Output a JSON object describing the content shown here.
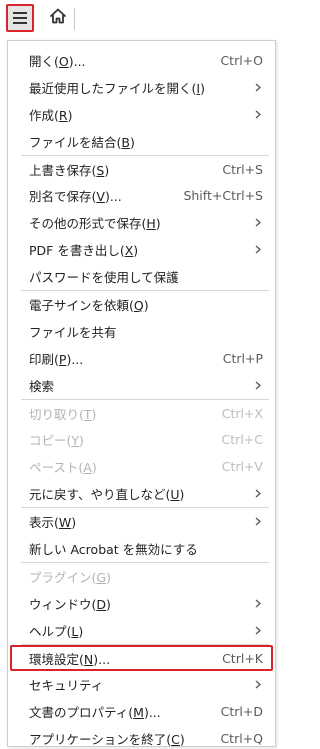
{
  "toolbar": {
    "menu_icon": "hamburger-menu-icon",
    "home_icon": "home-icon"
  },
  "menu": {
    "items": [
      {
        "label": "開く(",
        "mnemonic": "O",
        "suffix": ")...",
        "shortcut": "Ctrl+O",
        "submenu": false,
        "disabled": false
      },
      {
        "label": "最近使用したファイルを開く(",
        "mnemonic": "I",
        "suffix": ")",
        "shortcut": "",
        "submenu": true,
        "disabled": false
      },
      {
        "label": "作成(",
        "mnemonic": "R",
        "suffix": ")",
        "shortcut": "",
        "submenu": true,
        "disabled": false
      },
      {
        "label": "ファイルを結合(",
        "mnemonic": "B",
        "suffix": ")",
        "shortcut": "",
        "submenu": false,
        "disabled": false
      },
      {
        "label": "上書き保存(",
        "mnemonic": "S",
        "suffix": ")",
        "shortcut": "Ctrl+S",
        "submenu": false,
        "disabled": false
      },
      {
        "label": "別名で保存(",
        "mnemonic": "V",
        "suffix": ")...",
        "shortcut": "Shift+Ctrl+S",
        "submenu": false,
        "disabled": false
      },
      {
        "label": "その他の形式で保存(",
        "mnemonic": "H",
        "suffix": ")",
        "shortcut": "",
        "submenu": true,
        "disabled": false
      },
      {
        "label": "PDF を書き出し(",
        "mnemonic": "X",
        "suffix": ")",
        "shortcut": "",
        "submenu": true,
        "disabled": false
      },
      {
        "label": "パスワードを使用して保護",
        "mnemonic": "",
        "suffix": "",
        "shortcut": "",
        "submenu": false,
        "disabled": false
      },
      {
        "label": "電子サインを依頼(",
        "mnemonic": "Q",
        "suffix": ")",
        "shortcut": "",
        "submenu": false,
        "disabled": false
      },
      {
        "label": "ファイルを共有",
        "mnemonic": "",
        "suffix": "",
        "shortcut": "",
        "submenu": false,
        "disabled": false
      },
      {
        "label": "印刷(",
        "mnemonic": "P",
        "suffix": ")...",
        "shortcut": "Ctrl+P",
        "submenu": false,
        "disabled": false
      },
      {
        "label": "検索",
        "mnemonic": "",
        "suffix": "",
        "shortcut": "",
        "submenu": true,
        "disabled": false
      },
      {
        "label": "切り取り(",
        "mnemonic": "T",
        "suffix": ")",
        "shortcut": "Ctrl+X",
        "submenu": false,
        "disabled": true
      },
      {
        "label": "コピー(",
        "mnemonic": "Y",
        "suffix": ")",
        "shortcut": "Ctrl+C",
        "submenu": false,
        "disabled": true
      },
      {
        "label": "ペースト(",
        "mnemonic": "A",
        "suffix": ")",
        "shortcut": "Ctrl+V",
        "submenu": false,
        "disabled": true
      },
      {
        "label": "元に戻す、やり直しなど(",
        "mnemonic": "U",
        "suffix": ")",
        "shortcut": "",
        "submenu": true,
        "disabled": false
      },
      {
        "label": "表示(",
        "mnemonic": "W",
        "suffix": ")",
        "shortcut": "",
        "submenu": true,
        "disabled": false
      },
      {
        "label": "新しい Acrobat を無効にする",
        "mnemonic": "",
        "suffix": "",
        "shortcut": "",
        "submenu": false,
        "disabled": false
      },
      {
        "label": "プラグイン(",
        "mnemonic": "G",
        "suffix": ")",
        "shortcut": "",
        "submenu": false,
        "disabled": true
      },
      {
        "label": "ウィンドウ(",
        "mnemonic": "D",
        "suffix": ")",
        "shortcut": "",
        "submenu": true,
        "disabled": false
      },
      {
        "label": "ヘルプ(",
        "mnemonic": "L",
        "suffix": ")",
        "shortcut": "",
        "submenu": true,
        "disabled": false
      },
      {
        "label": "環境設定(",
        "mnemonic": "N",
        "suffix": ")...",
        "shortcut": "Ctrl+K",
        "submenu": false,
        "disabled": false,
        "highlighted": true
      },
      {
        "label": "セキュリティ",
        "mnemonic": "",
        "suffix": "",
        "shortcut": "",
        "submenu": true,
        "disabled": false
      },
      {
        "label": "文書のプロパティ(",
        "mnemonic": "M",
        "suffix": ")...",
        "shortcut": "Ctrl+D",
        "submenu": false,
        "disabled": false
      },
      {
        "label": "アプリケーションを終了(",
        "mnemonic": "C",
        "suffix": ")",
        "shortcut": "Ctrl+Q",
        "submenu": false,
        "disabled": false
      }
    ],
    "separators_after": [
      3,
      8,
      12,
      16,
      18,
      21
    ]
  },
  "colors": {
    "highlight_border": "#d9222a",
    "text": "#222222",
    "disabled_text": "#b4b4b4",
    "separator": "#d6d6d6"
  }
}
